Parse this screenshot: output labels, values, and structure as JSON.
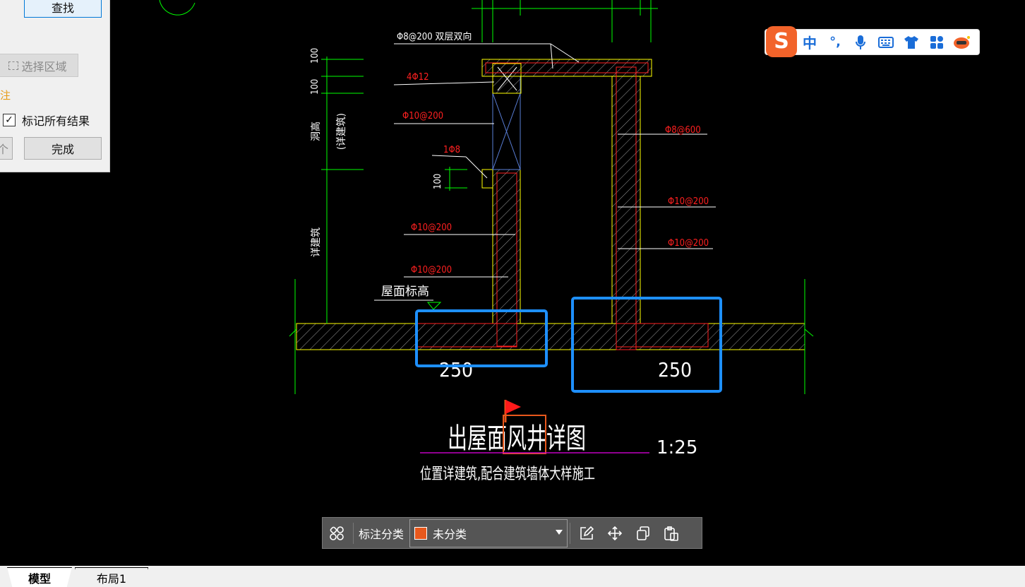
{
  "panel": {
    "find_button": "查找",
    "select_region_button": "选择区域",
    "annotation_label": "注",
    "mark_all_checkbox": "标记所有结果",
    "mark_all_checked": true,
    "prev_button": "个",
    "done_button": "完成"
  },
  "drawing": {
    "title": "出屋面风井详图",
    "title_highlight": "风井",
    "scale": "1:25",
    "subtitle": "位置详建筑,配合建筑墙体大样施工",
    "roof_level_label": "屋面标高",
    "dim_left": "250",
    "dim_right": "250",
    "dim_top_100a": "100",
    "dim_top_100b": "100",
    "dim_small_100": "100",
    "vert_label_1": "洞高",
    "vert_label_2": "(详建筑)",
    "vert_label_3": "详建筑",
    "rebar": {
      "top": "Φ8@200 双层双向",
      "corner": "4Φ12",
      "left_upper": "Φ10@200",
      "left_small": "1Φ8",
      "left_mid": "Φ10@200",
      "left_low": "Φ10@200",
      "right_top": "Φ8@600",
      "right_mid": "Φ10@200",
      "right_low": "Φ10@200"
    },
    "colors": {
      "dimension": "#00ff00",
      "rebar_text": "#ff2020",
      "outline": "#ffff00",
      "highlight_box": "#1e90ff",
      "title_line": "#c000c0"
    }
  },
  "ime": {
    "logo": "S",
    "items": [
      "中",
      "°,",
      "mic-icon",
      "keyboard-icon",
      "shirt-icon",
      "apps-icon",
      "mascot-icon"
    ],
    "mode_label": "中",
    "punct_label": "°,"
  },
  "annotation_toolbar": {
    "category_label": "标注分类",
    "category_value": "未分类",
    "category_color": "#e8581c"
  },
  "tabs": {
    "model": "模型",
    "layout1": "布局1"
  }
}
